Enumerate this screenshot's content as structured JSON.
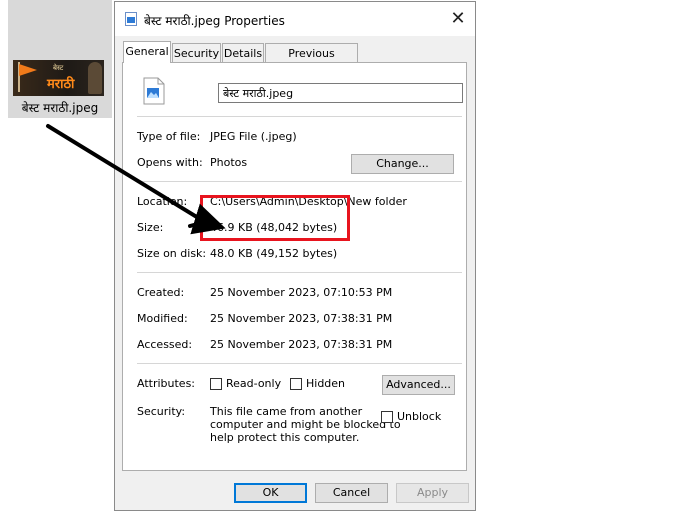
{
  "desktop": {
    "icon_label": "बेस्ट मराठी.jpeg",
    "thumb_small_text": "बेस्ट",
    "thumb_word": "मराठी"
  },
  "window": {
    "title": "बेस्ट मराठी.jpeg Properties",
    "close_label": "✕"
  },
  "tabs": [
    {
      "label": "General",
      "active": true
    },
    {
      "label": "Security",
      "active": false
    },
    {
      "label": "Details",
      "active": false
    },
    {
      "label": "Previous Versions",
      "active": false
    }
  ],
  "general": {
    "file_name": "बेस्ट मराठी.jpeg",
    "type_label": "Type of file:",
    "type_value": "JPEG File (.jpeg)",
    "opens_label": "Opens with:",
    "opens_value": "Photos",
    "change_button": "Change...",
    "location_label": "Location:",
    "location_value": "C:\\Users\\Admin\\Desktop\\New folder",
    "size_label": "Size:",
    "size_value": "46.9 KB (48,042 bytes)",
    "size_disk_label": "Size on disk:",
    "size_disk_value": "48.0 KB (49,152 bytes)",
    "created_label": "Created:",
    "created_value": "25 November 2023, 07:10:53 PM",
    "modified_label": "Modified:",
    "modified_value": "25 November 2023, 07:38:31 PM",
    "accessed_label": "Accessed:",
    "accessed_value": "25 November 2023, 07:38:31 PM",
    "attributes_label": "Attributes:",
    "readonly_label": "Read-only",
    "hidden_label": "Hidden",
    "advanced_button": "Advanced...",
    "security_label": "Security:",
    "security_line1": "This file came from another",
    "security_line2": "computer and might be blocked to",
    "security_line3": "help protect this computer.",
    "unblock_label": "Unblock"
  },
  "buttons": {
    "ok": "OK",
    "cancel": "Cancel",
    "apply": "Apply"
  },
  "colors": {
    "annotation_red": "#e8141e",
    "focus_blue": "#0078d7"
  }
}
